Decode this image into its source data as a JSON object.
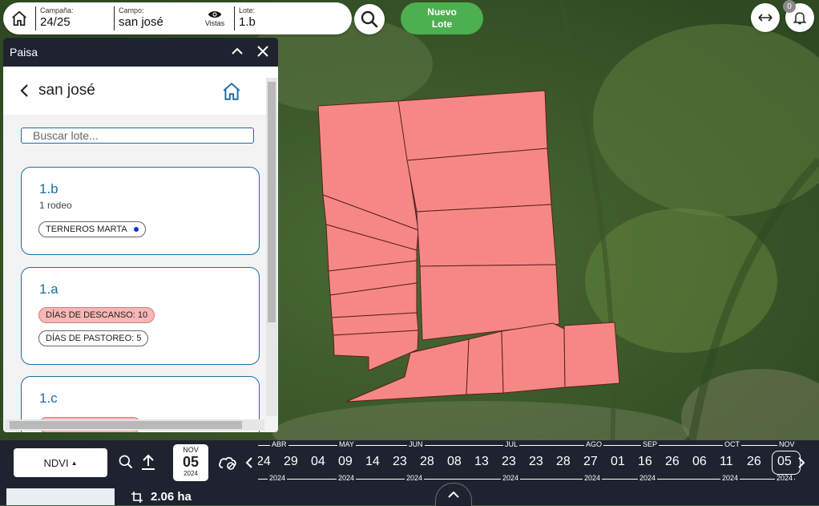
{
  "topbar": {
    "campana_label": "Campaña:",
    "campana_value": "24/25",
    "campo_label": "Campo:",
    "campo_value": "san josé",
    "vistas_label": "Vistas",
    "lote_label": "Lote:",
    "lote_value": "1.b",
    "nuevo_lote_line1": "Nuevo",
    "nuevo_lote_line2": "Lote",
    "notifications_count": "0",
    "icons": [
      "home-icon",
      "eye-icon",
      "search-icon",
      "swap-arrows-icon",
      "bell-icon"
    ]
  },
  "panel": {
    "header_title": "Paisa",
    "field_name": "san josé",
    "search_placeholder": "Buscar lote...",
    "cards": [
      {
        "name": "1.b",
        "sub": "1 rodeo",
        "chips": [
          {
            "text": "TERNEROS MARTA",
            "style": "outline-dot"
          }
        ]
      },
      {
        "name": "1.a",
        "chips": [
          {
            "text": "DÍAS DE DESCANSO: 10",
            "style": "pink"
          },
          {
            "text": "DÍAS DE PASTOREO: 5",
            "style": "outline"
          }
        ]
      },
      {
        "name": "1.c",
        "chips": []
      }
    ]
  },
  "timeline": {
    "layer_label": "NDVI",
    "selected_month": "NOV",
    "selected_day": "05",
    "selected_year": "2024",
    "months": [
      "ABR",
      "MAY",
      "JUN",
      "JUL",
      "AGO",
      "SEP",
      "OCT",
      "NOV"
    ],
    "year": "2024",
    "days": [
      "24",
      "29",
      "04",
      "09",
      "14",
      "23",
      "28",
      "08",
      "13",
      "23",
      "23",
      "28",
      "27",
      "01",
      "16",
      "26",
      "06",
      "11",
      "26",
      "05"
    ]
  },
  "footer": {
    "area": "2.06 ha"
  },
  "colors": {
    "lot_fill": "#ff8a8a",
    "accent_blue": "#1a6fa0",
    "nuevo_green": "#4caf50",
    "dark_bar": "#1f2330"
  }
}
